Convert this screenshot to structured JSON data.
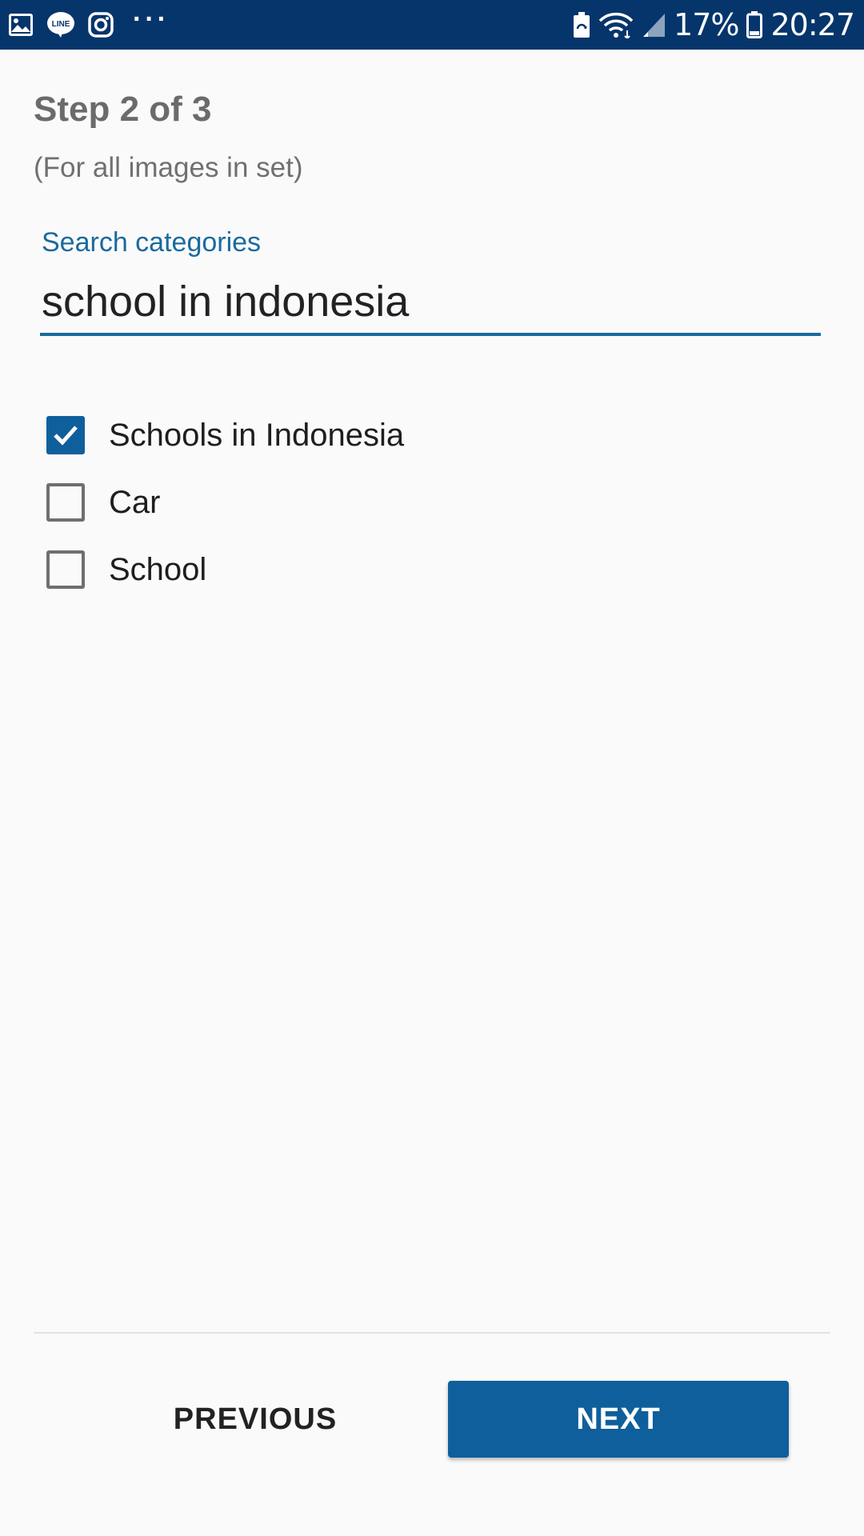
{
  "status_bar": {
    "left_icons": [
      "gallery-icon",
      "line-app-icon",
      "instagram-icon",
      "more-notifications-icon"
    ],
    "more_dots": "···",
    "right_icons": [
      "battery-saver-icon",
      "wifi-icon",
      "cell-signal-icon",
      "battery-icon"
    ],
    "battery_percent": "17%",
    "time": "20:27",
    "background_color": "#05356b"
  },
  "header": {
    "title": "Step 2 of 3",
    "subtitle": "(For all images in set)"
  },
  "search": {
    "label": "Search categories",
    "value": "school in indonesia"
  },
  "categories": [
    {
      "label": "Schools in Indonesia",
      "checked": true
    },
    {
      "label": "Car",
      "checked": false
    },
    {
      "label": "School",
      "checked": false
    }
  ],
  "footer": {
    "previous_label": "PREVIOUS",
    "next_label": "NEXT"
  },
  "colors": {
    "accent": "#0f5f9c",
    "label_blue": "#1a6a9e",
    "background": "#fafafa"
  }
}
